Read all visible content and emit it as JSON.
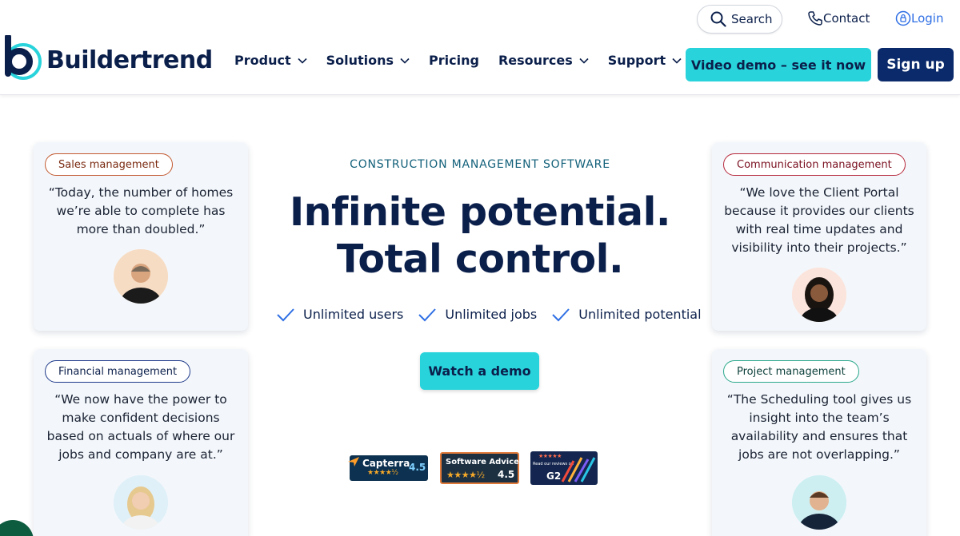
{
  "header": {
    "brand": "Buildertrend",
    "search_label": "Search",
    "contact_label": "Contact",
    "login_label": "Login",
    "nav": [
      {
        "label": "Product",
        "has_dropdown": true
      },
      {
        "label": "Solutions",
        "has_dropdown": true
      },
      {
        "label": "Pricing",
        "has_dropdown": false
      },
      {
        "label": "Resources",
        "has_dropdown": true
      },
      {
        "label": "Support",
        "has_dropdown": true
      }
    ],
    "demo_button": "Video demo – see it now",
    "signup_button": "Sign up"
  },
  "hero": {
    "eyebrow": "CONSTRUCTION MANAGEMENT SOFTWARE",
    "headline_line1": "Infinite potential.",
    "headline_line2": "Total control.",
    "checks": [
      "Unlimited users",
      "Unlimited jobs",
      "Unlimited potential"
    ],
    "cta": "Watch a demo"
  },
  "badges": {
    "capterra": {
      "name": "Capterra",
      "rating": "4.5",
      "stars": "★★★★½"
    },
    "software_advice": {
      "name": "Software Advice.",
      "rating": "4.5",
      "stars": "★★★★½"
    },
    "g2": {
      "name": "G2",
      "caption": "Read our reviews on",
      "stars": "★★★★★"
    }
  },
  "testimonials": [
    {
      "tag": "Sales management",
      "quote": "“Today, the number of homes we’re able to complete has more than doubled.”"
    },
    {
      "tag": "Communication management",
      "quote": "“We love the Client Portal because it provides our clients with real time updates and visibility into their projects.”"
    },
    {
      "tag": "Financial management",
      "quote": "“We now have the power to make confident decisions based on actuals of where our jobs and company are at.”"
    },
    {
      "tag": "Project management",
      "quote": "“The Scheduling tool gives us insight into the team’s availability and ensures that jobs are not overlapping.”"
    }
  ],
  "colors": {
    "navy": "#0b1f4b",
    "teal_button": "#28d3db",
    "signup_bg": "#0b2a6b",
    "login_blue": "#2f6fe4",
    "card_bg": "#f3f7fb"
  },
  "icons": [
    "search-icon",
    "phone-icon",
    "lock-icon",
    "chevron-down-icon",
    "check-icon"
  ]
}
